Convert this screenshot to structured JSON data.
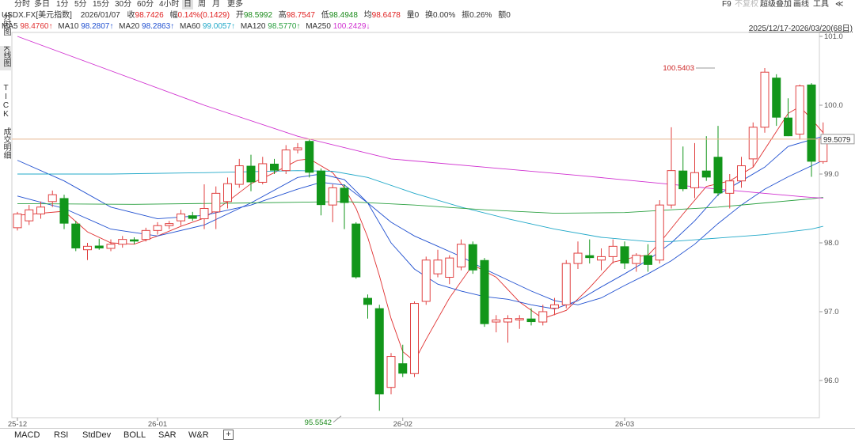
{
  "toolbar": {
    "timeframes": [
      "分时",
      "多日",
      "1分",
      "5分",
      "15分",
      "30分",
      "60分",
      "4小时",
      "日",
      "周",
      "月",
      "更多"
    ],
    "active_timeframe": "日",
    "right_tools": [
      "F9",
      "不复权",
      "超级叠加",
      "画线",
      "工具",
      "≪"
    ]
  },
  "left_panel": {
    "items": [
      "分时图",
      "K线图",
      "TICK",
      "成交明细"
    ]
  },
  "quote": {
    "symbol": "USDX.FX[美元指数]",
    "date": "2026/01/07",
    "close_label": "收",
    "close": "98.7426",
    "change_label": "幅",
    "change": "0.14%(0.1429)",
    "open_label": "开",
    "open": "98.5992",
    "high_label": "高",
    "high": "98.7547",
    "low_label": "低",
    "low": "98.4948",
    "avg_label": "均",
    "avg": "98.6478",
    "volume_label": "量",
    "volume": "0",
    "turnover_label": "换",
    "turnover": "0.00%",
    "amplitude_label": "振",
    "amplitude": "0.26%",
    "amount_label": "额",
    "amount": "0"
  },
  "ma_legend": [
    {
      "label": "MA5",
      "value": "98.4760↑",
      "color": "#e03030"
    },
    {
      "label": "MA10",
      "value": "98.2807↑",
      "color": "#2050d0"
    },
    {
      "label": "MA20",
      "value": "98.2863↑",
      "color": "#2050d0"
    },
    {
      "label": "MA60",
      "value": "99.0057↑",
      "color": "#20a8c8"
    },
    {
      "label": "MA120",
      "value": "98.5770↑",
      "color": "#2aa040"
    },
    {
      "label": "MA250",
      "value": "100.2429↓",
      "color": "#d030d0"
    }
  ],
  "range_label": "2025/12/17-2026/03/20(68日)",
  "bottom_tabs": [
    "MACD",
    "RSI",
    "StdDev",
    "BOLL",
    "SAR",
    "W&R"
  ],
  "chart_data": {
    "type": "candlestick",
    "ylim": [
      95.3,
      101.1
    ],
    "yticks": [
      96.0,
      97.0,
      98.0,
      99.0,
      100.0,
      101.0
    ],
    "ytick_labels": [
      "96.0",
      "97.0",
      "98.0",
      "99.0",
      "100.0",
      "101.0"
    ],
    "current_price": "99.5079",
    "current_price_value": 99.5079,
    "x_labels": [
      {
        "label": "25-12",
        "index": 0
      },
      {
        "label": "26-01",
        "index": 12
      },
      {
        "label": "26-02",
        "index": 33
      },
      {
        "label": "26-03",
        "index": 52
      }
    ],
    "annotations": [
      {
        "text": "100.5403",
        "index": 60,
        "value": 100.5403,
        "type": "high"
      },
      {
        "text": "95.5542",
        "index": 28,
        "value": 95.5542,
        "type": "low"
      }
    ],
    "candles": [
      {
        "o": 98.22,
        "h": 98.45,
        "l": 98.18,
        "c": 98.42
      },
      {
        "o": 98.32,
        "h": 98.55,
        "l": 98.26,
        "c": 98.48
      },
      {
        "o": 98.42,
        "h": 98.6,
        "l": 98.35,
        "c": 98.52
      },
      {
        "o": 98.6,
        "h": 98.76,
        "l": 98.52,
        "c": 98.7
      },
      {
        "o": 98.65,
        "h": 98.7,
        "l": 98.2,
        "c": 98.28
      },
      {
        "o": 98.28,
        "h": 98.32,
        "l": 97.88,
        "c": 97.92
      },
      {
        "o": 97.9,
        "h": 98.0,
        "l": 97.75,
        "c": 97.95
      },
      {
        "o": 97.96,
        "h": 98.06,
        "l": 97.9,
        "c": 97.92
      },
      {
        "o": 97.92,
        "h": 98.05,
        "l": 97.88,
        "c": 97.98
      },
      {
        "o": 97.98,
        "h": 98.1,
        "l": 97.93,
        "c": 98.05
      },
      {
        "o": 98.05,
        "h": 98.08,
        "l": 97.98,
        "c": 98.02
      },
      {
        "o": 98.05,
        "h": 98.22,
        "l": 98.02,
        "c": 98.18
      },
      {
        "o": 98.18,
        "h": 98.3,
        "l": 98.12,
        "c": 98.25
      },
      {
        "o": 98.25,
        "h": 98.32,
        "l": 98.2,
        "c": 98.28
      },
      {
        "o": 98.32,
        "h": 98.48,
        "l": 98.25,
        "c": 98.42
      },
      {
        "o": 98.4,
        "h": 98.45,
        "l": 98.32,
        "c": 98.35
      },
      {
        "o": 98.35,
        "h": 98.85,
        "l": 98.2,
        "c": 98.5
      },
      {
        "o": 98.45,
        "h": 98.82,
        "l": 98.2,
        "c": 98.72
      },
      {
        "o": 98.6,
        "h": 98.95,
        "l": 98.5,
        "c": 98.86
      },
      {
        "o": 98.85,
        "h": 99.22,
        "l": 98.8,
        "c": 99.12
      },
      {
        "o": 99.12,
        "h": 99.28,
        "l": 98.75,
        "c": 98.88
      },
      {
        "o": 98.88,
        "h": 99.25,
        "l": 98.85,
        "c": 99.15
      },
      {
        "o": 99.15,
        "h": 99.22,
        "l": 99.0,
        "c": 99.05
      },
      {
        "o": 99.05,
        "h": 99.42,
        "l": 99.0,
        "c": 99.35
      },
      {
        "o": 99.35,
        "h": 99.45,
        "l": 99.3,
        "c": 99.38
      },
      {
        "o": 99.48,
        "h": 99.5,
        "l": 98.95,
        "c": 99.02
      },
      {
        "o": 99.05,
        "h": 99.08,
        "l": 98.4,
        "c": 98.55
      },
      {
        "o": 98.55,
        "h": 98.85,
        "l": 98.3,
        "c": 98.8
      },
      {
        "o": 98.8,
        "h": 98.85,
        "l": 98.2,
        "c": 98.58
      },
      {
        "o": 98.28,
        "h": 98.3,
        "l": 97.48,
        "c": 97.5
      },
      {
        "o": 97.2,
        "h": 97.25,
        "l": 96.9,
        "c": 97.1
      },
      {
        "o": 97.05,
        "h": 97.1,
        "l": 95.56,
        "c": 95.8
      },
      {
        "o": 95.9,
        "h": 96.4,
        "l": 95.8,
        "c": 96.35
      },
      {
        "o": 96.25,
        "h": 96.52,
        "l": 96.05,
        "c": 96.1
      },
      {
        "o": 96.1,
        "h": 97.15,
        "l": 96.05,
        "c": 97.12
      },
      {
        "o": 97.15,
        "h": 97.8,
        "l": 97.1,
        "c": 97.75
      },
      {
        "o": 97.55,
        "h": 97.9,
        "l": 97.5,
        "c": 97.75
      },
      {
        "o": 97.5,
        "h": 97.82,
        "l": 97.4,
        "c": 97.78
      },
      {
        "o": 97.65,
        "h": 98.05,
        "l": 97.6,
        "c": 97.98
      },
      {
        "o": 97.98,
        "h": 98.02,
        "l": 97.55,
        "c": 97.6
      },
      {
        "o": 97.75,
        "h": 97.78,
        "l": 96.78,
        "c": 96.82
      },
      {
        "o": 96.85,
        "h": 96.95,
        "l": 96.7,
        "c": 96.88
      },
      {
        "o": 96.85,
        "h": 96.95,
        "l": 96.55,
        "c": 96.9
      },
      {
        "o": 96.88,
        "h": 96.95,
        "l": 96.75,
        "c": 96.9
      },
      {
        "o": 96.9,
        "h": 97.05,
        "l": 96.8,
        "c": 96.85
      },
      {
        "o": 96.85,
        "h": 97.1,
        "l": 96.8,
        "c": 97.0
      },
      {
        "o": 97.05,
        "h": 97.2,
        "l": 96.95,
        "c": 97.1
      },
      {
        "o": 97.1,
        "h": 97.75,
        "l": 97.05,
        "c": 97.7
      },
      {
        "o": 97.7,
        "h": 98.02,
        "l": 97.62,
        "c": 97.85
      },
      {
        "o": 97.82,
        "h": 98.05,
        "l": 97.7,
        "c": 97.78
      },
      {
        "o": 97.75,
        "h": 97.92,
        "l": 97.6,
        "c": 97.8
      },
      {
        "o": 97.8,
        "h": 98.05,
        "l": 97.7,
        "c": 97.95
      },
      {
        "o": 97.95,
        "h": 98.02,
        "l": 97.62,
        "c": 97.7
      },
      {
        "o": 97.7,
        "h": 97.85,
        "l": 97.58,
        "c": 97.82
      },
      {
        "o": 97.82,
        "h": 97.98,
        "l": 97.58,
        "c": 97.68
      },
      {
        "o": 97.75,
        "h": 98.62,
        "l": 97.7,
        "c": 98.55
      },
      {
        "o": 98.55,
        "h": 99.68,
        "l": 98.5,
        "c": 99.05
      },
      {
        "o": 99.05,
        "h": 99.4,
        "l": 98.75,
        "c": 98.78
      },
      {
        "o": 98.8,
        "h": 99.45,
        "l": 98.65,
        "c": 99.02
      },
      {
        "o": 99.05,
        "h": 99.55,
        "l": 98.9,
        "c": 98.95
      },
      {
        "o": 99.25,
        "h": 99.7,
        "l": 98.68,
        "c": 98.72
      },
      {
        "o": 98.72,
        "h": 99.0,
        "l": 98.5,
        "c": 98.9
      },
      {
        "o": 98.9,
        "h": 99.25,
        "l": 98.8,
        "c": 99.12
      },
      {
        "o": 99.22,
        "h": 99.75,
        "l": 99.1,
        "c": 99.68
      },
      {
        "o": 99.68,
        "h": 100.54,
        "l": 99.6,
        "c": 100.48
      },
      {
        "o": 100.4,
        "h": 100.45,
        "l": 99.7,
        "c": 99.82
      },
      {
        "o": 99.82,
        "h": 100.1,
        "l": 99.55,
        "c": 99.55
      },
      {
        "o": 99.58,
        "h": 100.3,
        "l": 99.5,
        "c": 100.28
      },
      {
        "o": 100.3,
        "h": 100.32,
        "l": 98.96,
        "c": 99.18
      },
      {
        "o": 99.18,
        "h": 99.75,
        "l": 99.15,
        "c": 99.51
      }
    ],
    "ma_series": [
      {
        "name": "MA5",
        "color": "#e03030",
        "values": [
          [
            0,
            98.4
          ],
          [
            4,
            98.46
          ],
          [
            6,
            98.16
          ],
          [
            8,
            98.0
          ],
          [
            10,
            97.98
          ],
          [
            12,
            98.1
          ],
          [
            14,
            98.24
          ],
          [
            16,
            98.36
          ],
          [
            18,
            98.6
          ],
          [
            20,
            98.86
          ],
          [
            22,
            99.02
          ],
          [
            24,
            99.2
          ],
          [
            25,
            99.22
          ],
          [
            27,
            99.02
          ],
          [
            28,
            98.8
          ],
          [
            29,
            98.5
          ],
          [
            30,
            98.08
          ],
          [
            31,
            97.52
          ],
          [
            32,
            96.9
          ],
          [
            33,
            96.42
          ],
          [
            34,
            96.28
          ],
          [
            35,
            96.6
          ],
          [
            37,
            97.2
          ],
          [
            39,
            97.68
          ],
          [
            41,
            97.5
          ],
          [
            43,
            97.14
          ],
          [
            45,
            96.9
          ],
          [
            47,
            97.02
          ],
          [
            49,
            97.35
          ],
          [
            51,
            97.72
          ],
          [
            53,
            97.8
          ],
          [
            54,
            97.82
          ],
          [
            55,
            98.0
          ],
          [
            57,
            98.42
          ],
          [
            59,
            98.82
          ],
          [
            61,
            98.9
          ],
          [
            63,
            99.1
          ],
          [
            65,
            99.62
          ],
          [
            66,
            99.88
          ],
          [
            67,
            99.98
          ],
          [
            68,
            99.8
          ],
          [
            69,
            99.6
          ]
        ]
      },
      {
        "name": "MA10",
        "color": "#2050d0",
        "values": [
          [
            0,
            98.68
          ],
          [
            4,
            98.5
          ],
          [
            8,
            98.2
          ],
          [
            12,
            98.1
          ],
          [
            16,
            98.26
          ],
          [
            20,
            98.58
          ],
          [
            24,
            98.95
          ],
          [
            26,
            99.0
          ],
          [
            28,
            98.92
          ],
          [
            30,
            98.58
          ],
          [
            32,
            98.0
          ],
          [
            34,
            97.62
          ],
          [
            36,
            97.4
          ],
          [
            38,
            97.3
          ],
          [
            40,
            97.22
          ],
          [
            42,
            97.18
          ],
          [
            44,
            97.1
          ],
          [
            46,
            97.04
          ],
          [
            48,
            97.16
          ],
          [
            50,
            97.36
          ],
          [
            52,
            97.55
          ],
          [
            54,
            97.75
          ],
          [
            56,
            98.0
          ],
          [
            58,
            98.32
          ],
          [
            60,
            98.7
          ],
          [
            62,
            98.9
          ],
          [
            64,
            99.1
          ],
          [
            66,
            99.4
          ],
          [
            68,
            99.5
          ],
          [
            69,
            99.55
          ]
        ]
      },
      {
        "name": "MA20",
        "color": "#2050d0",
        "values": [
          [
            0,
            99.2
          ],
          [
            4,
            98.9
          ],
          [
            8,
            98.52
          ],
          [
            12,
            98.35
          ],
          [
            16,
            98.4
          ],
          [
            20,
            98.55
          ],
          [
            24,
            98.78
          ],
          [
            26,
            98.88
          ],
          [
            28,
            98.84
          ],
          [
            30,
            98.58
          ],
          [
            32,
            98.3
          ],
          [
            34,
            98.1
          ],
          [
            36,
            97.95
          ],
          [
            38,
            97.8
          ],
          [
            40,
            97.62
          ],
          [
            42,
            97.46
          ],
          [
            44,
            97.3
          ],
          [
            46,
            97.16
          ],
          [
            48,
            97.1
          ],
          [
            50,
            97.2
          ],
          [
            52,
            97.38
          ],
          [
            54,
            97.55
          ],
          [
            56,
            97.74
          ],
          [
            58,
            97.98
          ],
          [
            60,
            98.28
          ],
          [
            62,
            98.55
          ],
          [
            64,
            98.78
          ],
          [
            66,
            98.96
          ],
          [
            68,
            99.12
          ],
          [
            69,
            99.2
          ]
        ]
      },
      {
        "name": "MA60",
        "color": "#20a8c8",
        "values": [
          [
            0,
            99.0
          ],
          [
            8,
            99.0
          ],
          [
            16,
            99.02
          ],
          [
            24,
            99.05
          ],
          [
            27,
            99.04
          ],
          [
            30,
            98.95
          ],
          [
            34,
            98.72
          ],
          [
            38,
            98.52
          ],
          [
            42,
            98.35
          ],
          [
            46,
            98.2
          ],
          [
            50,
            98.08
          ],
          [
            54,
            98.02
          ],
          [
            56,
            98.02
          ],
          [
            60,
            98.07
          ],
          [
            64,
            98.12
          ],
          [
            68,
            98.2
          ],
          [
            69,
            98.24
          ]
        ]
      },
      {
        "name": "MA120",
        "color": "#2aa040",
        "values": [
          [
            0,
            98.57
          ],
          [
            10,
            98.56
          ],
          [
            20,
            98.58
          ],
          [
            28,
            98.6
          ],
          [
            34,
            98.55
          ],
          [
            40,
            98.48
          ],
          [
            46,
            98.43
          ],
          [
            52,
            98.44
          ],
          [
            56,
            98.48
          ],
          [
            60,
            98.52
          ],
          [
            64,
            98.58
          ],
          [
            68,
            98.64
          ],
          [
            69,
            98.66
          ]
        ]
      },
      {
        "name": "MA250",
        "color": "#d030d0",
        "values": [
          [
            0,
            101.0
          ],
          [
            8,
            100.5
          ],
          [
            16,
            100.0
          ],
          [
            24,
            99.55
          ],
          [
            32,
            99.22
          ],
          [
            40,
            99.1
          ],
          [
            48,
            98.98
          ],
          [
            56,
            98.85
          ],
          [
            60,
            98.78
          ],
          [
            64,
            98.72
          ],
          [
            68,
            98.66
          ],
          [
            69,
            98.65
          ]
        ]
      }
    ]
  }
}
